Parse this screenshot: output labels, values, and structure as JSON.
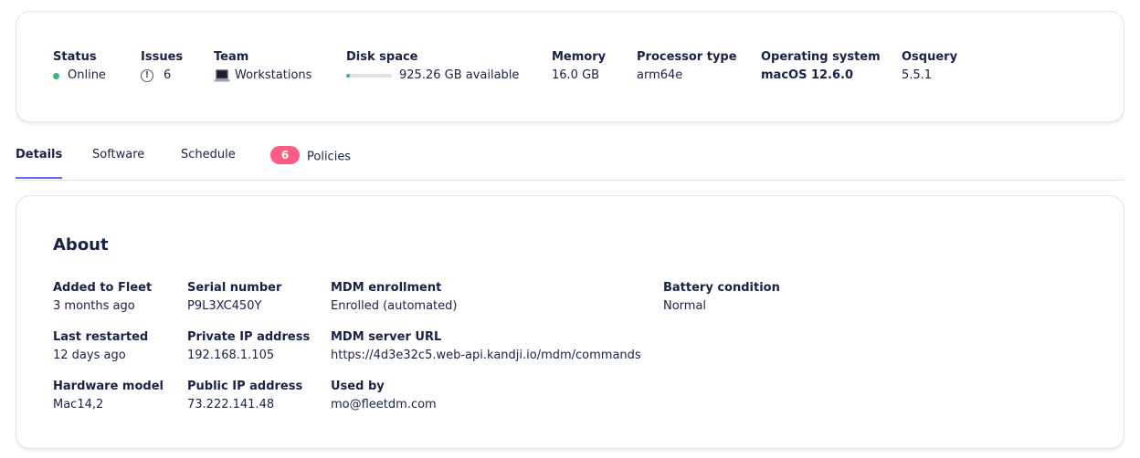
{
  "summary": {
    "status": {
      "label": "Status",
      "value": "Online"
    },
    "issues": {
      "label": "Issues",
      "value": "6"
    },
    "team": {
      "label": "Team",
      "value": "Workstations"
    },
    "disk": {
      "label": "Disk space",
      "value": "925.26 GB available",
      "used_fraction": 0.08
    },
    "memory": {
      "label": "Memory",
      "value": "16.0 GB"
    },
    "processor": {
      "label": "Processor type",
      "value": "arm64e"
    },
    "os": {
      "label": "Operating system",
      "value": "macOS 12.6.0"
    },
    "osquery": {
      "label": "Osquery",
      "value": "5.5.1"
    }
  },
  "tabs": [
    {
      "label": "Details"
    },
    {
      "label": "Software"
    },
    {
      "label": "Schedule"
    },
    {
      "label": "Policies",
      "badge": "6"
    }
  ],
  "about": {
    "title": "About",
    "added": {
      "label": "Added to Fleet",
      "value": "3 months ago"
    },
    "restarted": {
      "label": "Last restarted",
      "value": "12 days ago"
    },
    "hardware": {
      "label": "Hardware model",
      "value": "Mac14,2"
    },
    "serial": {
      "label": "Serial number",
      "value": "P9L3XC450Y"
    },
    "private_ip": {
      "label": "Private IP address",
      "value": "192.168.1.105"
    },
    "public_ip": {
      "label": "Public IP address",
      "value": "73.222.141.48"
    },
    "mdm_enrollment": {
      "label": "MDM enrollment",
      "value": "Enrolled (automated)"
    },
    "mdm_server": {
      "label": "MDM server URL",
      "value": "https://4d3e32c5.web-api.kandji.io/mdm/commands"
    },
    "used_by": {
      "label": "Used by",
      "value": "mo@fleetdm.com"
    },
    "battery": {
      "label": "Battery condition",
      "value": "Normal"
    }
  },
  "colors": {
    "accent": "#6a67fe",
    "online": "#3db67b",
    "badge": "#ff5c83"
  }
}
